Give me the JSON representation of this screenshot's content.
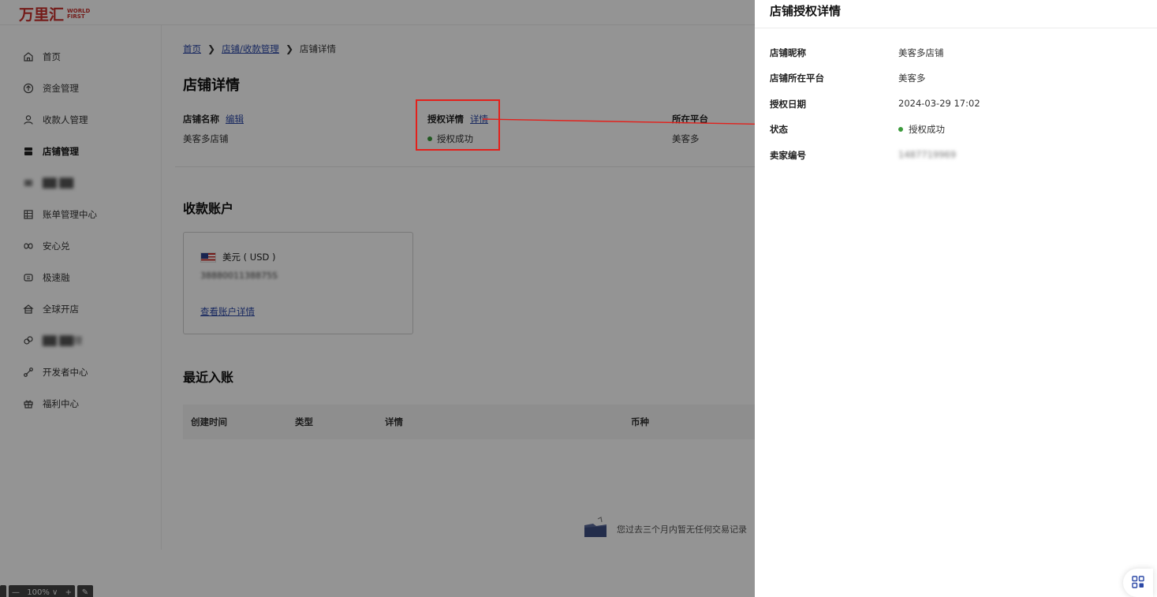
{
  "brand": {
    "name_cn": "万里汇",
    "name_en": "WORLD FIRST",
    "color": "#c8302c"
  },
  "sidebar": {
    "items": [
      {
        "label": "首页",
        "icon": "home-icon"
      },
      {
        "label": "资金管理",
        "icon": "funds-icon"
      },
      {
        "label": "收款人管理",
        "icon": "user-icon"
      },
      {
        "label": "店铺管理",
        "icon": "store-icon"
      },
      {
        "label": "██ ██",
        "icon": "blurred-icon"
      },
      {
        "label": "账单管理中心",
        "icon": "bill-icon"
      },
      {
        "label": "安心兑",
        "icon": "exchange-icon"
      },
      {
        "label": "极速融",
        "icon": "finance-icon"
      },
      {
        "label": "全球开店",
        "icon": "global-store-icon"
      },
      {
        "label": "██ ██理",
        "icon": "blurred-icon"
      },
      {
        "label": "开发者中心",
        "icon": "developer-icon"
      },
      {
        "label": "福利中心",
        "icon": "gift-icon"
      }
    ]
  },
  "breadcrumb": {
    "home": "首页",
    "store_mgmt": "店铺/收款管理",
    "current": "店铺详情"
  },
  "page": {
    "title": "店铺详情",
    "store_name_label": "店铺名称",
    "edit_link": "编辑",
    "store_name_value": "美客多店铺",
    "auth_label": "授权详情",
    "detail_link": "详情",
    "auth_status": "授权成功",
    "platform_label": "所在平台",
    "platform_value": "美客多"
  },
  "accounts": {
    "title": "收款账户",
    "currency": "美元 ( USD )",
    "number": "3888001138875S",
    "view_link": "查看账户详情"
  },
  "recent": {
    "title": "最近入账",
    "columns": [
      "创建时间",
      "类型",
      "详情",
      "币种"
    ],
    "empty_text": "您过去三个月内暂无任何交易记录"
  },
  "zoom": {
    "minus": "—",
    "level": "100% ∨",
    "plus": "+",
    "edit": "✎"
  },
  "drawer": {
    "title": "店铺授权详情",
    "rows": [
      {
        "label": "店铺昵称",
        "value": "美客多店铺"
      },
      {
        "label": "店铺所在平台",
        "value": "美客多"
      },
      {
        "label": "授权日期",
        "value": "2024-03-29 17:02"
      },
      {
        "label": "状态",
        "value": "授权成功"
      },
      {
        "label": "卖家编号",
        "value": "1487719969"
      }
    ]
  },
  "colors": {
    "link": "#2b48a6",
    "success": "#3b9a3b",
    "annotation": "#e3201b"
  }
}
